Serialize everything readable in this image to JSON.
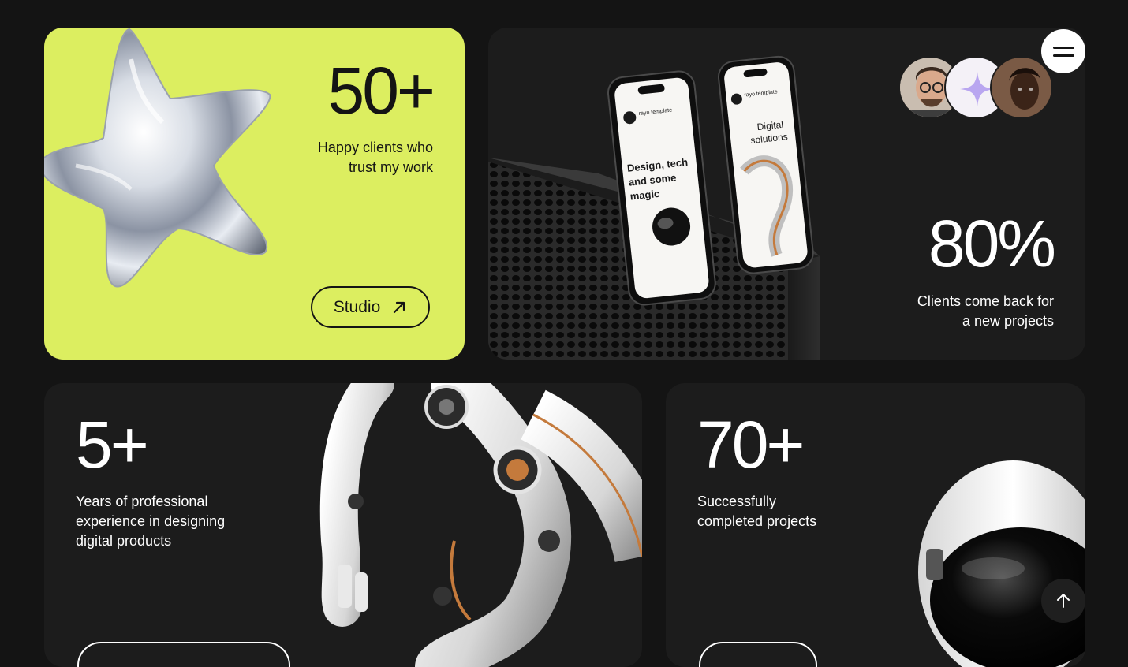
{
  "cards": {
    "clients": {
      "number": "50+",
      "desc_line1": "Happy clients who",
      "desc_line2": "trust my work",
      "button_label": "Studio",
      "button_icon": "arrow-up-right-icon",
      "art": "chrome-star-image"
    },
    "returning": {
      "number": "80%",
      "desc_line1": "Clients come back for",
      "desc_line2": "a new projects",
      "art": "phones-mockup-image",
      "avatars": [
        "avatar-man-glasses",
        "avatar-sparkle-icon",
        "avatar-woman"
      ],
      "phone_texts": {
        "brand": "rayo template",
        "phone1_text": "Design, tech and some magic",
        "phone2_text": "Digital solutions"
      }
    },
    "years": {
      "number": "5+",
      "desc_line1": "Years of professional",
      "desc_line2": "experience in designing",
      "desc_line3": "digital products",
      "art": "robot-arm-image"
    },
    "projects": {
      "number": "70+",
      "desc_line1": "Successfully",
      "desc_line2": "completed projects",
      "art": "astronaut-helmet-image"
    }
  },
  "floating": {
    "menu_icon": "hamburger-menu-icon",
    "scroll_top_icon": "arrow-up-icon"
  },
  "colors": {
    "background": "#141414",
    "card_dark": "#1c1c1c",
    "accent_lime": "#dcee60",
    "text_light": "#ffffff",
    "text_dark": "#141414"
  }
}
